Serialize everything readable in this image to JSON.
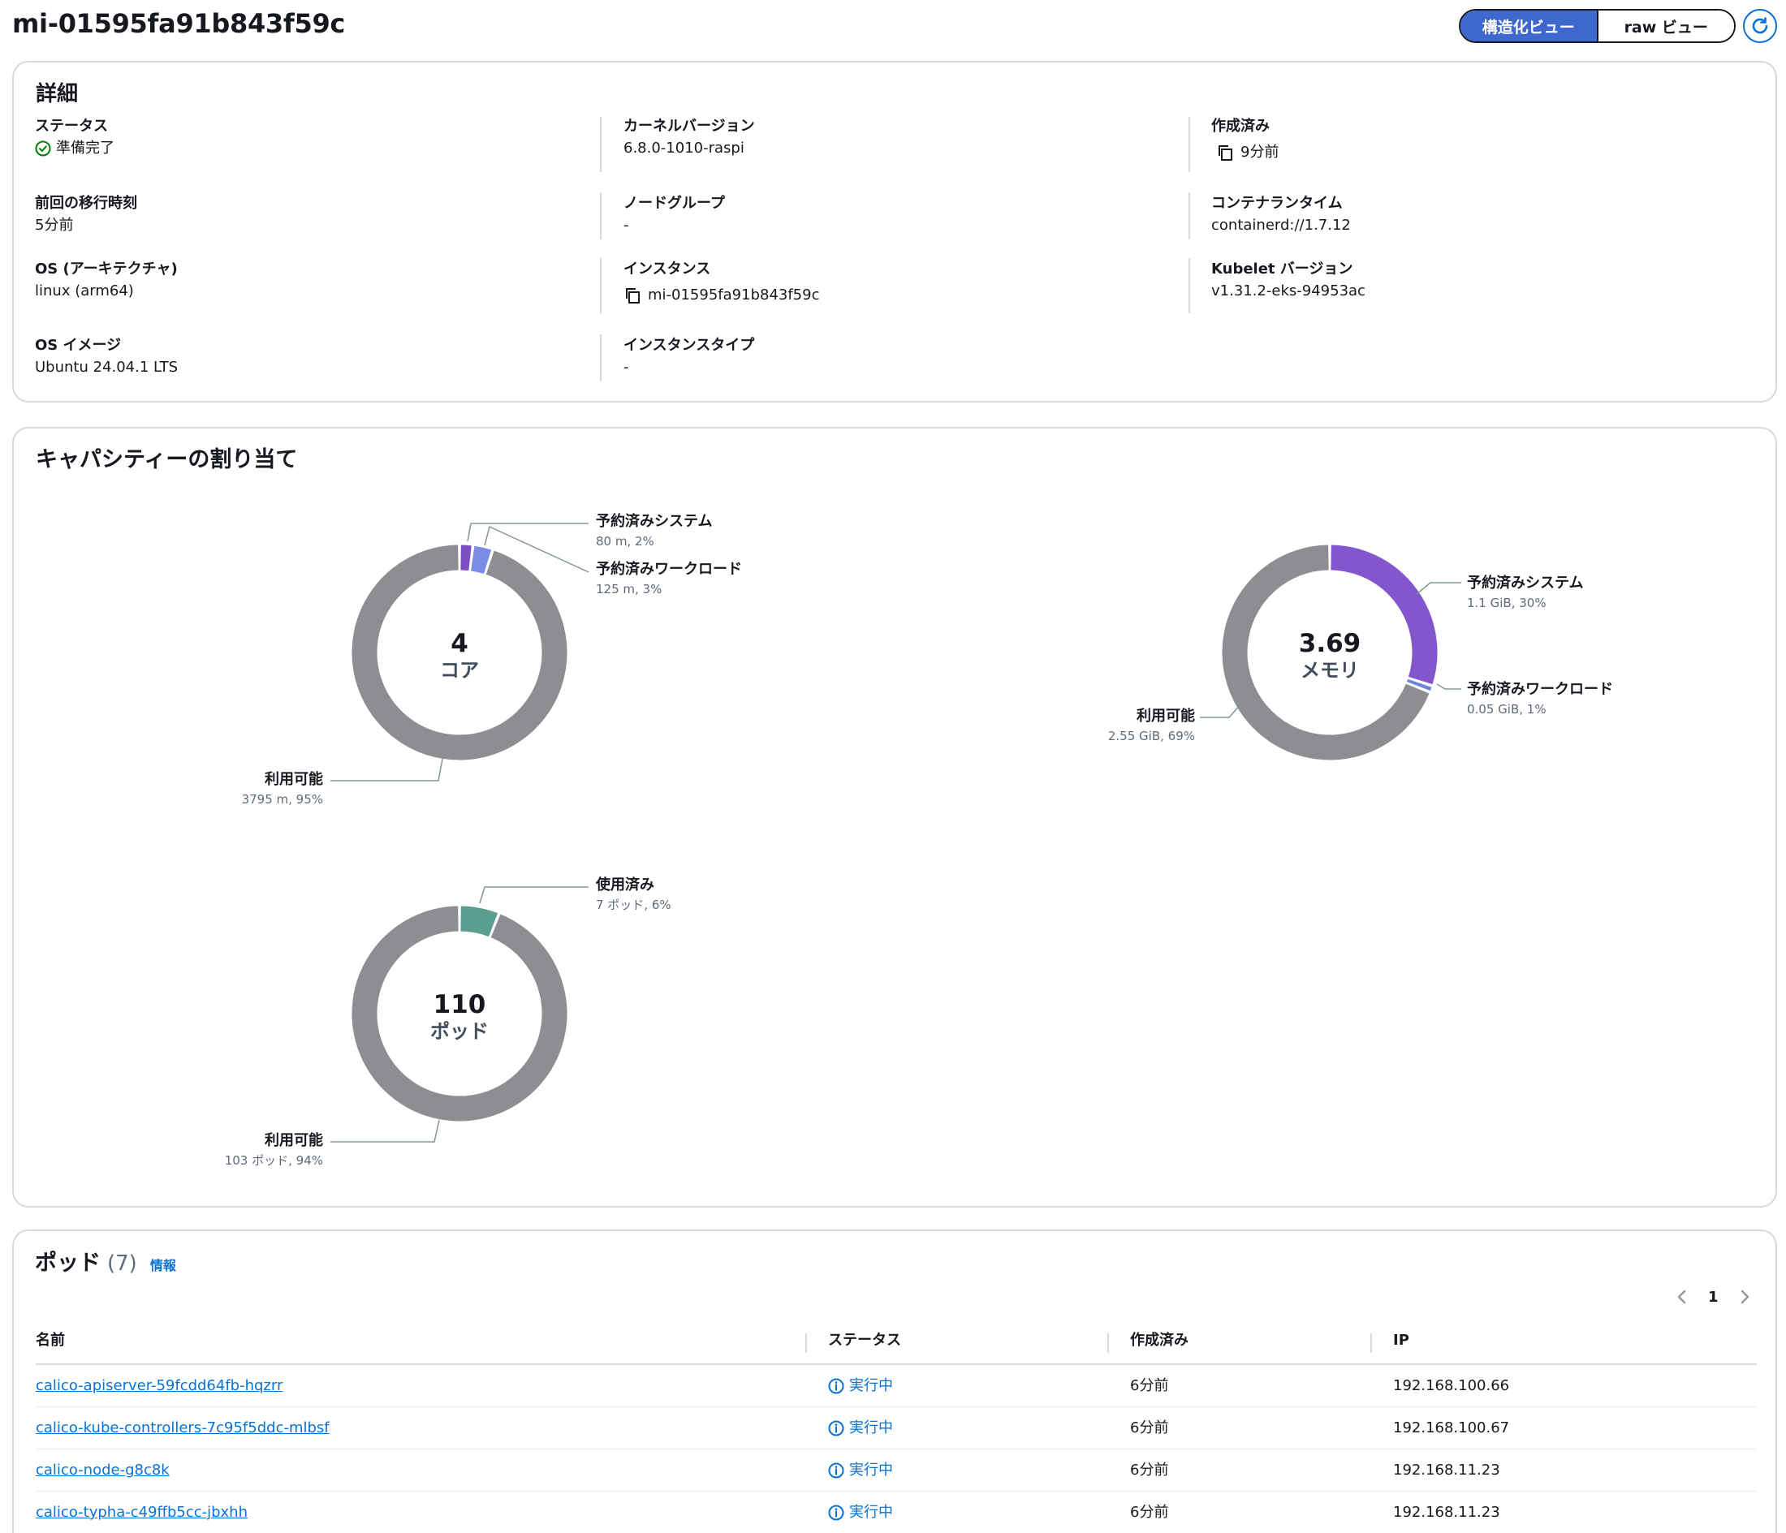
{
  "header": {
    "title": "mi-01595fa91b843f59c",
    "view_structured": "構造化ビュー",
    "view_raw": "raw ビュー"
  },
  "details": {
    "title": "詳細",
    "status_label": "ステータス",
    "status_value": "準備完了",
    "last_transition_label": "前回の移行時刻",
    "last_transition_value": "5分前",
    "os_arch_label": "OS (アーキテクチャ)",
    "os_arch_value": "linux (arm64)",
    "os_image_label": "OS イメージ",
    "os_image_value": "Ubuntu 24.04.1 LTS",
    "kernel_label": "カーネルバージョン",
    "kernel_value": "6.8.0-1010-raspi",
    "nodegroup_label": "ノードグループ",
    "nodegroup_value": "-",
    "instance_label": "インスタンス",
    "instance_value": "mi-01595fa91b843f59c",
    "instance_type_label": "インスタンスタイプ",
    "instance_type_value": "-",
    "created_label": "作成済み",
    "created_value": "9分前",
    "container_runtime_label": "コンテナランタイム",
    "container_runtime_value": "containerd://1.7.12",
    "kubelet_label": "Kubelet バージョン",
    "kubelet_value": "v1.31.2-eks-94953ac"
  },
  "capacity": {
    "title": "キャパシティーの割り当て",
    "colors": {
      "available": "#8d8e91",
      "reserved_system_cpu": "#7d4fc2",
      "reserved_workload_cpu": "#7b8ce6",
      "reserved_system_mem": "#8456ce",
      "reserved_workload_mem": "#6c86e0",
      "used_pods": "#5a9e8f"
    },
    "cpu": {
      "center_value": "4",
      "center_unit": "コア",
      "reserved_system_label": "予約済みシステム",
      "reserved_system_detail": "80 m, 2%",
      "reserved_workload_label": "予約済みワークロード",
      "reserved_workload_detail": "125 m, 3%",
      "available_label": "利用可能",
      "available_detail": "3795 m, 95%"
    },
    "memory": {
      "center_value": "3.69",
      "center_unit": "メモリ",
      "reserved_system_label": "予約済みシステム",
      "reserved_system_detail": "1.1 GiB, 30%",
      "reserved_workload_label": "予約済みワークロード",
      "reserved_workload_detail": "0.05 GiB, 1%",
      "available_label": "利用可能",
      "available_detail": "2.55 GiB, 69%"
    },
    "pods": {
      "center_value": "110",
      "center_unit": "ポッド",
      "used_label": "使用済み",
      "used_detail": "7 ポッド, 6%",
      "available_label": "利用可能",
      "available_detail": "103 ポッド, 94%"
    }
  },
  "pods_table": {
    "title": "ポッド",
    "count": "(7)",
    "info": "情報",
    "page": "1",
    "columns": [
      "名前",
      "ステータス",
      "作成済み",
      "IP"
    ],
    "rows": [
      {
        "name": "calico-apiserver-59fcdd64fb-hqzrr",
        "status": "実行中",
        "created": "6分前",
        "ip": "192.168.100.66"
      },
      {
        "name": "calico-kube-controllers-7c95f5ddc-mlbsf",
        "status": "実行中",
        "created": "6分前",
        "ip": "192.168.100.67"
      },
      {
        "name": "calico-node-g8c8k",
        "status": "実行中",
        "created": "6分前",
        "ip": "192.168.11.23"
      },
      {
        "name": "calico-typha-c49ffb5cc-jbxhh",
        "status": "実行中",
        "created": "6分前",
        "ip": "192.168.11.23"
      }
    ]
  }
}
